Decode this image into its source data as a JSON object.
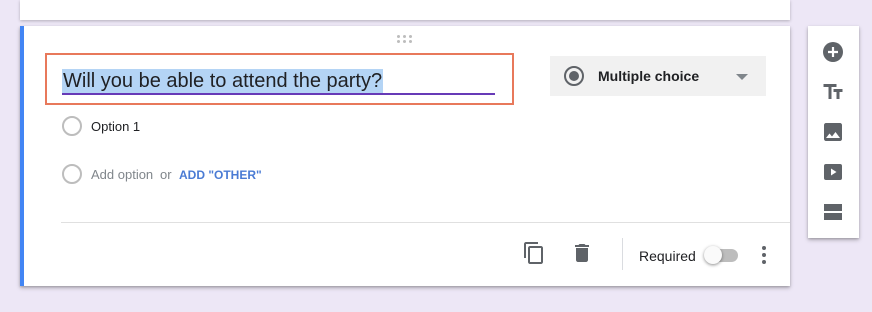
{
  "question": {
    "title": "Will you be able to attend the party?",
    "type_label": "Multiple choice",
    "options": [
      {
        "label": "Option 1"
      }
    ],
    "add_option_placeholder": "Add option",
    "or_text": "or",
    "add_other_label": "ADD \"OTHER\""
  },
  "footer": {
    "required_label": "Required",
    "required_on": false,
    "icons": [
      "copy-icon",
      "delete-icon",
      "more-vert-icon"
    ]
  },
  "side_toolbar": {
    "icons": [
      "add-question-icon",
      "add-title-icon",
      "add-image-icon",
      "add-video-icon",
      "add-section-icon"
    ]
  },
  "colors": {
    "background": "#ede7f6",
    "accent_bar": "#4285f4",
    "title_underline": "#673ab7",
    "highlight_box": "#e8795b",
    "selection": "#b4d4f5",
    "add_other": "#4a7bd4"
  }
}
